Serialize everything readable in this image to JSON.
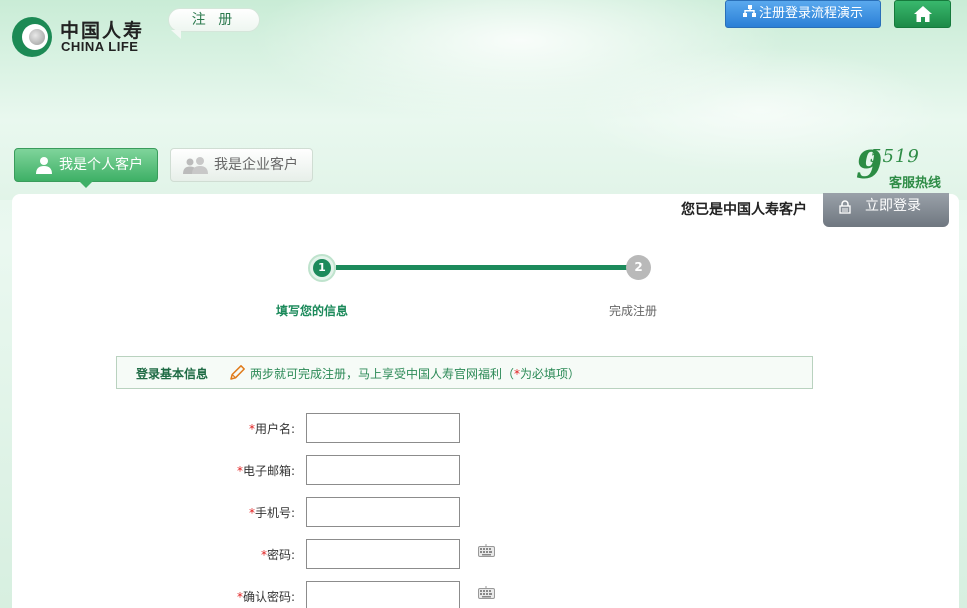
{
  "header": {
    "logo_cn": "中国人寿",
    "logo_en": "CHINA LIFE",
    "register_tab": "注 册",
    "flow_demo_button": "注册登录流程演示"
  },
  "customer_tabs": {
    "personal": "我是个人客户",
    "enterprise": "我是企业客户"
  },
  "hotline": {
    "nine": "9",
    "number_rest": "5519",
    "label": "客服热线"
  },
  "login": {
    "already_customer": "您已是中国人寿客户",
    "login_button": "立即登录"
  },
  "steps": [
    {
      "number": "1",
      "label": "填写您的信息",
      "active": true
    },
    {
      "number": "2",
      "label": "完成注册",
      "active": false
    }
  ],
  "infobar": {
    "title": "登录基本信息",
    "tip_before": "两步就可完成注册，马上享受中国人寿官网福利（",
    "tip_star": "*",
    "tip_after": "为必填项）"
  },
  "form": {
    "required_mark": "*",
    "fields": [
      {
        "label": "用户名:",
        "value": ""
      },
      {
        "label": "电子邮箱:",
        "value": ""
      },
      {
        "label": "手机号:",
        "value": ""
      },
      {
        "label": "密码:",
        "value": ""
      },
      {
        "label": "确认密码:",
        "value": ""
      }
    ]
  },
  "colors": {
    "brand_green": "#1c8a5b",
    "required_red": "#e02020",
    "flow_button_blue": "#2a7fd6"
  }
}
